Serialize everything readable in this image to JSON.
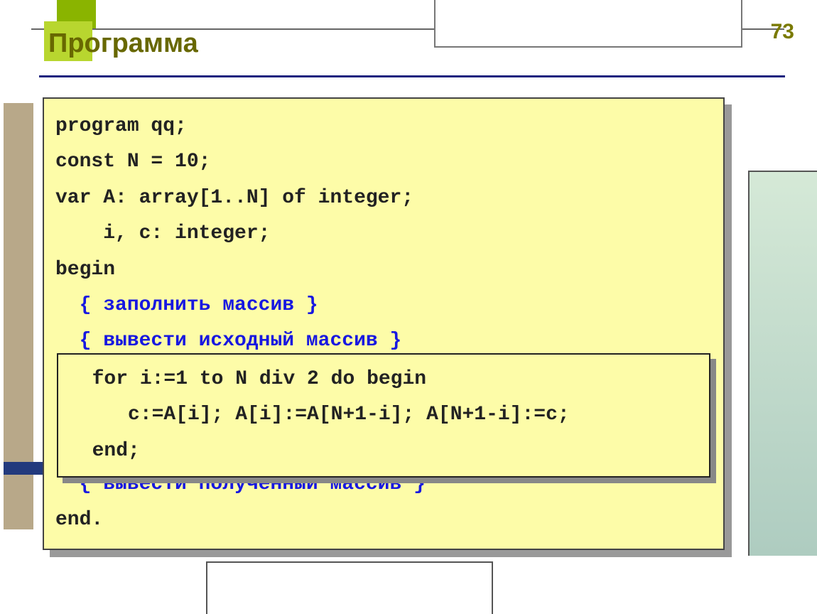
{
  "page_number": "73",
  "title": "Программа",
  "code": {
    "l1": "program qq;",
    "l2": "const N = 10;",
    "l3": "var A: array[1..N] of integer;",
    "l4": "    i, c: integer;",
    "l5": "begin",
    "c1": "  { заполнить массив }",
    "c2": "  { вывести исходный массив }",
    "c3": "  { вывести полученный массив }",
    "l6": "end."
  },
  "inner": {
    "l1": "  for i:=1 to N div 2 do begin",
    "l2": "     c:=A[i]; A[i]:=A[N+1-i]; A[N+1-i]:=c;",
    "l3": "  end;"
  }
}
